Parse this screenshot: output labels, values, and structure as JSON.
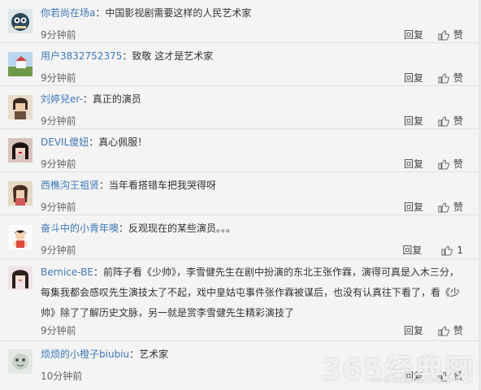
{
  "colors": {
    "username": "#3d77b9",
    "text": "#333333",
    "meta": "#666666",
    "background": "#f4f4f4"
  },
  "icons": {
    "like": "thumbs-up-icon"
  },
  "comments": [
    {
      "user": "你若尚在场a",
      "text": "中国影视剧需要这样的人民艺术家",
      "time": "9分钟前",
      "reply": "回复",
      "like": "赞"
    },
    {
      "user": "用户3832752375",
      "text": "致敬 这才是艺术家",
      "time": "9分钟前",
      "reply": "回复",
      "like": "赞"
    },
    {
      "user": "刘婷兒er-",
      "text": "真正的演员",
      "time": "9分钟前",
      "reply": "回复",
      "like": "赞"
    },
    {
      "user": "DEVIL傻妞",
      "text": "真心佩服！",
      "time": "9分钟前",
      "reply": "回复",
      "like": "赞"
    },
    {
      "user": "西樵沟王祖贤",
      "text": "当年看搭错车把我哭得呀",
      "time": "9分钟前",
      "reply": "回复",
      "like": "赞"
    },
    {
      "user": "奋斗中的小青年噢",
      "text": "反观现在的某些演员。。。",
      "time": "9分钟前",
      "reply": "回复",
      "like": "1"
    },
    {
      "user": "Bernice-BE",
      "text": "前阵子看《少帅》，李雪健先生在剧中扮演的东北王张作霖，演得可真是入木三分，每集我都会感叹先生演技太了不起，戏中皇姑屯事件张作霖被谋后，也没有认真往下看了，看《少帅》除了了解历史文脉，另一就是赏李雪健先生精彩演技了",
      "time": "9分钟前",
      "reply": "回复",
      "like": "赞"
    },
    {
      "user": "烦烦的小橙子biubiu",
      "text": "艺术家",
      "time": "10分钟前",
      "reply": "回复",
      "like": "赞"
    }
  ],
  "watermark": {
    "brand": "365经典网",
    "url": "www.365jingdian.com"
  }
}
